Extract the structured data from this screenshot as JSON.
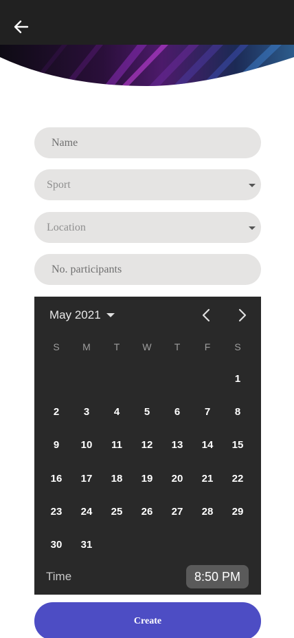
{
  "header": {
    "back_icon": "arrow-left-icon"
  },
  "form": {
    "name_placeholder": "Name",
    "sport_placeholder": "Sport",
    "location_placeholder": "Location",
    "participants_placeholder": "No. participants"
  },
  "calendar": {
    "month_label": "May 2021",
    "weekdays": [
      "S",
      "M",
      "T",
      "W",
      "T",
      "F",
      "S"
    ],
    "leading_blanks": 6,
    "days": [
      "1",
      "2",
      "3",
      "4",
      "5",
      "6",
      "7",
      "8",
      "9",
      "10",
      "11",
      "12",
      "13",
      "14",
      "15",
      "16",
      "17",
      "18",
      "19",
      "20",
      "21",
      "22",
      "23",
      "24",
      "25",
      "26",
      "27",
      "28",
      "29",
      "30",
      "31"
    ],
    "time_label": "Time",
    "time_value": "8:50 PM"
  },
  "actions": {
    "create_label": "Create"
  },
  "colors": {
    "topbar": "#212121",
    "field_bg": "#e5e4e3",
    "calendar_bg": "#292929",
    "accent": "#4d4dc4"
  }
}
